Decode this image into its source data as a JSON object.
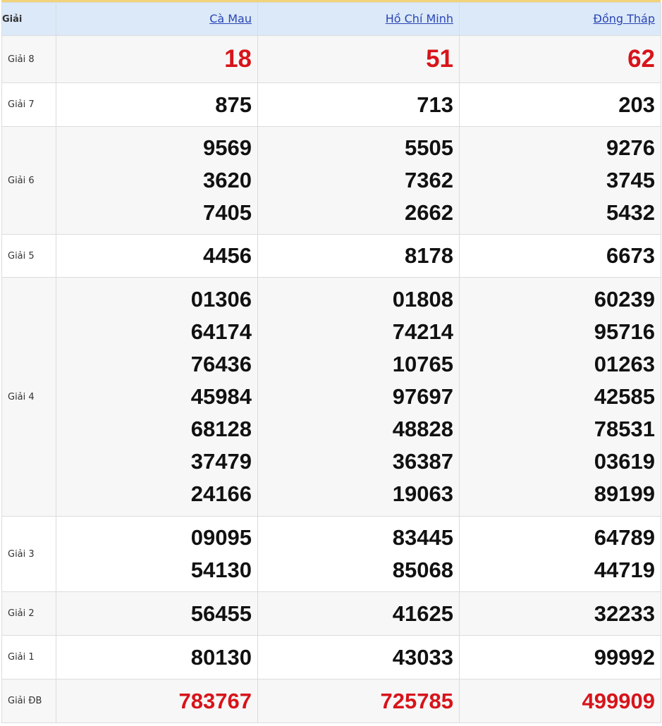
{
  "header": {
    "label": "Giải",
    "provinces": [
      "Cà Mau",
      "Hồ Chí Minh",
      "Đồng Tháp"
    ]
  },
  "colors": {
    "special_red": "#d7141a",
    "header_bg": "#dbe9f8",
    "link_blue": "#2a45b5",
    "top_border": "#f2d27a"
  },
  "prizes": [
    {
      "key": "g8",
      "label": "Giải 8",
      "red": true,
      "values": [
        [
          "18"
        ],
        [
          "51"
        ],
        [
          "62"
        ]
      ]
    },
    {
      "key": "g7",
      "label": "Giải 7",
      "red": false,
      "values": [
        [
          "875"
        ],
        [
          "713"
        ],
        [
          "203"
        ]
      ]
    },
    {
      "key": "g6",
      "label": "Giải 6",
      "red": false,
      "values": [
        [
          "9569",
          "3620",
          "7405"
        ],
        [
          "5505",
          "7362",
          "2662"
        ],
        [
          "9276",
          "3745",
          "5432"
        ]
      ]
    },
    {
      "key": "g5",
      "label": "Giải 5",
      "red": false,
      "values": [
        [
          "4456"
        ],
        [
          "8178"
        ],
        [
          "6673"
        ]
      ]
    },
    {
      "key": "g4",
      "label": "Giải 4",
      "red": false,
      "values": [
        [
          "01306",
          "64174",
          "76436",
          "45984",
          "68128",
          "37479",
          "24166"
        ],
        [
          "01808",
          "74214",
          "10765",
          "97697",
          "48828",
          "36387",
          "19063"
        ],
        [
          "60239",
          "95716",
          "01263",
          "42585",
          "78531",
          "03619",
          "89199"
        ]
      ]
    },
    {
      "key": "g3",
      "label": "Giải 3",
      "red": false,
      "values": [
        [
          "09095",
          "54130"
        ],
        [
          "83445",
          "85068"
        ],
        [
          "64789",
          "44719"
        ]
      ]
    },
    {
      "key": "g2",
      "label": "Giải 2",
      "red": false,
      "values": [
        [
          "56455"
        ],
        [
          "41625"
        ],
        [
          "32233"
        ]
      ]
    },
    {
      "key": "g1",
      "label": "Giải 1",
      "red": false,
      "values": [
        [
          "80130"
        ],
        [
          "43033"
        ],
        [
          "99992"
        ]
      ]
    },
    {
      "key": "gdb",
      "label": "Giải ĐB",
      "red": true,
      "values": [
        [
          "783767"
        ],
        [
          "725785"
        ],
        [
          "499909"
        ]
      ]
    }
  ]
}
